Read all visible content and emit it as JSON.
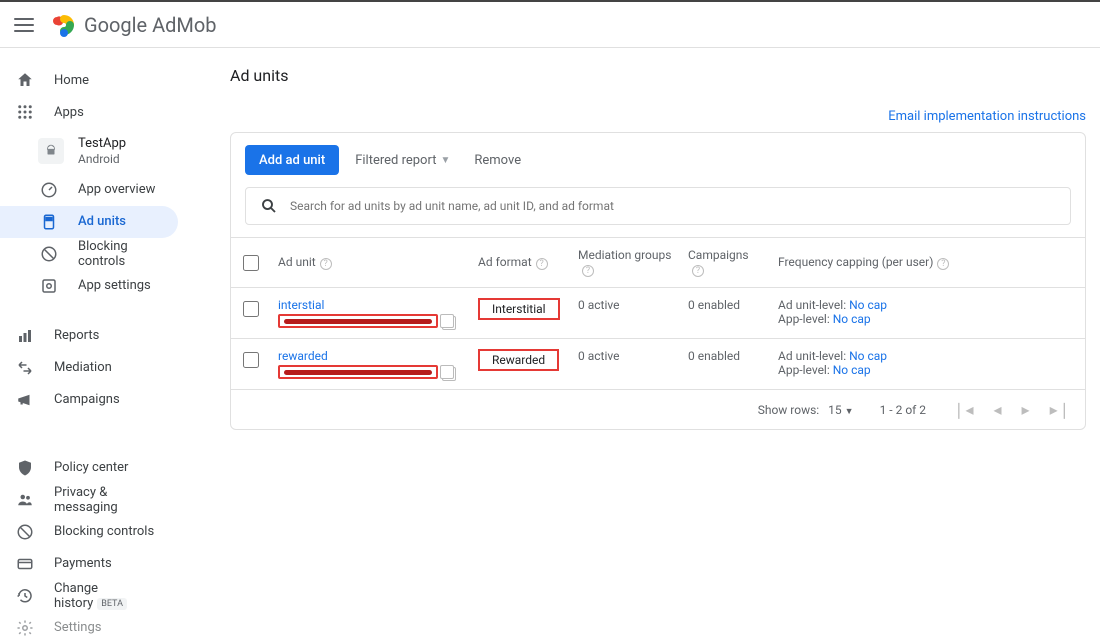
{
  "header": {
    "product_prefix": "Google",
    "product_suffix": "AdMob"
  },
  "sidebar": {
    "main": [
      {
        "label": "Home",
        "name": "home"
      },
      {
        "label": "Apps",
        "name": "apps"
      }
    ],
    "app": {
      "name": "TestApp",
      "platform": "Android"
    },
    "app_items": [
      {
        "label": "App overview"
      },
      {
        "label": "Ad units"
      },
      {
        "label": "Blocking controls"
      },
      {
        "label": "App settings"
      }
    ],
    "secondary": [
      {
        "label": "Reports"
      },
      {
        "label": "Mediation"
      },
      {
        "label": "Campaigns"
      }
    ],
    "bottom": [
      {
        "label": "Policy center"
      },
      {
        "label": "Privacy & messaging"
      },
      {
        "label": "Blocking controls"
      },
      {
        "label": "Payments"
      },
      {
        "label": "Change history",
        "badge": "BETA"
      },
      {
        "label": "Settings"
      }
    ]
  },
  "page": {
    "title": "Ad units",
    "email_link": "Email implementation instructions",
    "add_button": "Add ad unit",
    "filtered": "Filtered report",
    "remove": "Remove",
    "search_placeholder": "Search for ad units by ad unit name, ad unit ID, and ad format",
    "columns": {
      "adunit": "Ad unit",
      "format": "Ad format",
      "mediation": "Mediation groups",
      "campaigns": "Campaigns",
      "freq": "Frequency capping (per user)"
    },
    "rows": [
      {
        "name": "interstial",
        "format": "Interstitial",
        "mediation": "0 active",
        "campaigns": "0 enabled",
        "cap_unit_label": "Ad unit-level:",
        "cap_unit_value": "No cap",
        "cap_app_label": "App-level:",
        "cap_app_value": "No cap"
      },
      {
        "name": "rewarded",
        "format": "Rewarded",
        "mediation": "0 active",
        "campaigns": "0 enabled",
        "cap_unit_label": "Ad unit-level:",
        "cap_unit_value": "No cap",
        "cap_app_label": "App-level:",
        "cap_app_value": "No cap"
      }
    ],
    "footer": {
      "show_rows_label": "Show rows:",
      "show_rows_value": "15",
      "range": "1 - 2 of 2"
    }
  }
}
